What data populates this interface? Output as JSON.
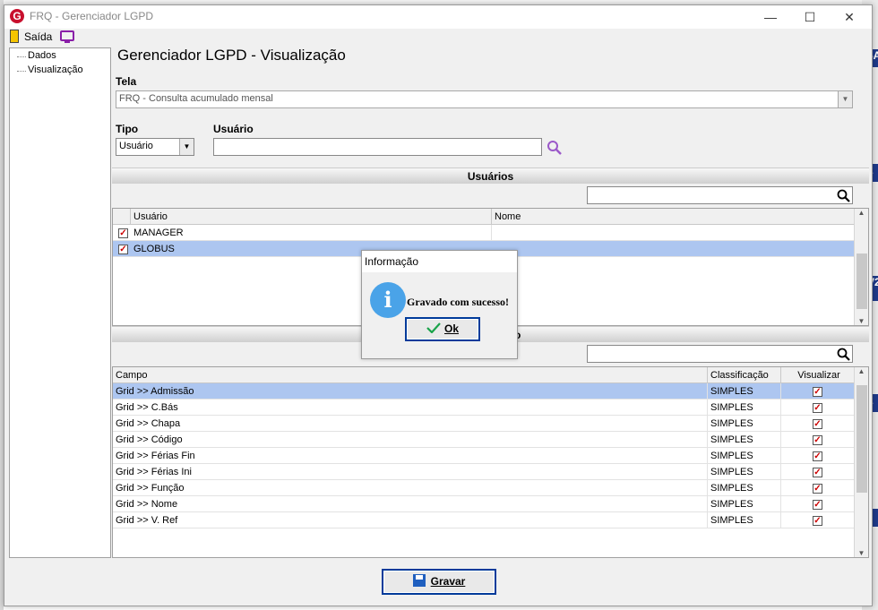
{
  "window": {
    "title": "FRQ - Gerenciador LGPD",
    "minimize_symbol": "—",
    "maximize_symbol": "☐",
    "close_symbol": "✕"
  },
  "toolbar": {
    "exit_label": "Saída",
    "exit_icon": "exit-door-icon",
    "monitor_icon": "monitor-icon"
  },
  "tree": {
    "items": [
      {
        "label": "Dados"
      },
      {
        "label": "Visualização"
      }
    ]
  },
  "page_title": "Gerenciador LGPD - Visualização",
  "form": {
    "tela_label": "Tela",
    "tela_value": "FRQ - Consulta acumulado mensal",
    "tipo_label": "Tipo",
    "tipo_value": "Usuário",
    "usuario_label": "Usuário",
    "usuario_value": ""
  },
  "users_section": {
    "title": "Usuários",
    "columns": [
      "Usuário",
      "Nome"
    ],
    "rows": [
      {
        "usuario": "MANAGER",
        "nome": "",
        "checked": true,
        "selected": false
      },
      {
        "usuario": "GLOBUS",
        "nome": "",
        "checked": true,
        "selected": true
      }
    ]
  },
  "fields_section": {
    "title_visible_fragment": "o",
    "columns": [
      "Campo",
      "Classificação",
      "Visualizar"
    ],
    "rows": [
      {
        "campo": "Grid >> Admissão",
        "classificacao": "SIMPLES",
        "visualizar": true,
        "selected": true
      },
      {
        "campo": "Grid >> C.Bás",
        "classificacao": "SIMPLES",
        "visualizar": true,
        "selected": false
      },
      {
        "campo": "Grid >> Chapa",
        "classificacao": "SIMPLES",
        "visualizar": true,
        "selected": false
      },
      {
        "campo": "Grid >> Código",
        "classificacao": "SIMPLES",
        "visualizar": true,
        "selected": false
      },
      {
        "campo": "Grid >> Férias Fin",
        "classificacao": "SIMPLES",
        "visualizar": true,
        "selected": false
      },
      {
        "campo": "Grid >> Férias Ini",
        "classificacao": "SIMPLES",
        "visualizar": true,
        "selected": false
      },
      {
        "campo": "Grid >> Função",
        "classificacao": "SIMPLES",
        "visualizar": true,
        "selected": false
      },
      {
        "campo": "Grid >> Nome",
        "classificacao": "SIMPLES",
        "visualizar": true,
        "selected": false
      },
      {
        "campo": "Grid >> V. Ref",
        "classificacao": "SIMPLES",
        "visualizar": true,
        "selected": false
      }
    ]
  },
  "dialog": {
    "title": "Informação",
    "message": "Gravado com sucesso!",
    "ok_label": "Ok",
    "icon": "info-icon"
  },
  "gravar_button": {
    "label": "Gravar",
    "icon": "floppy-disk-icon"
  },
  "background_fragments": [
    "5A",
    "2",
    "V2",
    "2"
  ],
  "colors": {
    "selection": "#adc6f0",
    "dialog_button_border": "#003b9a",
    "brand_red": "#c8102e",
    "info_blue": "#4aa3e8",
    "monitor_purple": "#8a1fa8",
    "check_red": "#cc0000"
  }
}
